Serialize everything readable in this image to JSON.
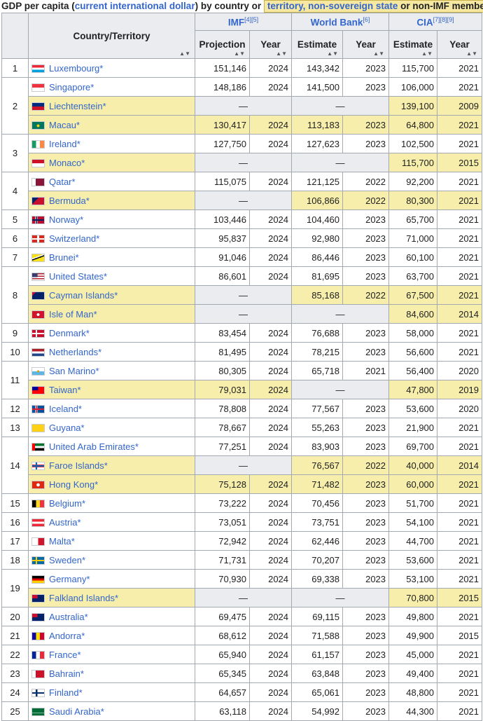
{
  "caption": {
    "text1": "GDP per capita (",
    "link": "current international dollar",
    "text2": ") by country or ",
    "box_a": "territory, ",
    "box_b": "non-sovereign state",
    "box_c": " or non-IMF member"
  },
  "header": {
    "country": "Country/Territory",
    "imf": "IMF",
    "imf_refs": "[4][5]",
    "wb": "World Bank",
    "wb_refs": "[6]",
    "cia": "CIA",
    "cia_refs": "[7][8][9]",
    "projection": "Projection",
    "estimate": "Estimate",
    "year": "Year",
    "sort_glyph": "▲▼"
  },
  "dash": "—",
  "star": "*",
  "colors": {
    "link": "#3366cc",
    "highlight": "#f6eeaa",
    "header_bg": "#eaecf0",
    "border": "#a2a9b1"
  },
  "rows": [
    {
      "rank": "1",
      "name": "Luxembourg",
      "flag": "luxembourg-flag",
      "f": "lu",
      "imf": "151,146",
      "imfy": "2024",
      "wb": "143,342",
      "wby": "2023",
      "cia": "115,700",
      "ciay": "2021",
      "terr": false
    },
    {
      "rank": "2",
      "name": "Singapore",
      "flag": "singapore-flag",
      "f": "sg",
      "imf": "148,186",
      "imfy": "2024",
      "wb": "141,500",
      "wby": "2023",
      "cia": "106,000",
      "ciay": "2021",
      "terr": false
    },
    {
      "rank": "",
      "name": "Liechtenstein",
      "flag": "liechtenstein-flag",
      "f": "li",
      "imf": null,
      "imfy": null,
      "wb": null,
      "wby": null,
      "cia": "139,100",
      "ciay": "2009",
      "terr": true
    },
    {
      "rank": "",
      "name": "Macau",
      "flag": "macau-flag",
      "f": "mo",
      "imf": "130,417",
      "imfy": "2024",
      "wb": "113,183",
      "wby": "2023",
      "cia": "64,800",
      "ciay": "2021",
      "terr": true
    },
    {
      "rank": "3",
      "name": "Ireland",
      "flag": "ireland-flag",
      "f": "ie",
      "imf": "127,750",
      "imfy": "2024",
      "wb": "127,623",
      "wby": "2023",
      "cia": "102,500",
      "ciay": "2021",
      "terr": false
    },
    {
      "rank": "",
      "name": "Monaco",
      "flag": "monaco-flag",
      "f": "mc",
      "imf": null,
      "imfy": null,
      "wb": null,
      "wby": null,
      "cia": "115,700",
      "ciay": "2015",
      "terr": true
    },
    {
      "rank": "4",
      "name": "Qatar",
      "flag": "qatar-flag",
      "f": "qa",
      "imf": "115,075",
      "imfy": "2024",
      "wb": "121,125",
      "wby": "2022",
      "cia": "92,200",
      "ciay": "2021",
      "terr": false
    },
    {
      "rank": "",
      "name": "Bermuda",
      "flag": "bermuda-flag",
      "f": "bm",
      "imf": null,
      "imfy": null,
      "wb": "106,866",
      "wby": "2022",
      "cia": "80,300",
      "ciay": "2021",
      "terr": true
    },
    {
      "rank": "5",
      "name": "Norway",
      "flag": "norway-flag",
      "f": "no",
      "imf": "103,446",
      "imfy": "2024",
      "wb": "104,460",
      "wby": "2023",
      "cia": "65,700",
      "ciay": "2021",
      "terr": false
    },
    {
      "rank": "6",
      "name": "Switzerland",
      "flag": "switzerland-flag",
      "f": "ch",
      "imf": "95,837",
      "imfy": "2024",
      "wb": "92,980",
      "wby": "2023",
      "cia": "71,000",
      "ciay": "2021",
      "terr": false
    },
    {
      "rank": "7",
      "name": "Brunei",
      "flag": "brunei-flag",
      "f": "bn",
      "imf": "91,046",
      "imfy": "2024",
      "wb": "86,446",
      "wby": "2023",
      "cia": "60,100",
      "ciay": "2021",
      "terr": false
    },
    {
      "rank": "8",
      "name": "United States",
      "flag": "united-states-flag",
      "f": "us",
      "imf": "86,601",
      "imfy": "2024",
      "wb": "81,695",
      "wby": "2023",
      "cia": "63,700",
      "ciay": "2021",
      "terr": false
    },
    {
      "rank": "",
      "name": "Cayman Islands",
      "flag": "cayman-islands-flag",
      "f": "ky",
      "imf": null,
      "imfy": null,
      "wb": "85,168",
      "wby": "2022",
      "cia": "67,500",
      "ciay": "2021",
      "terr": true
    },
    {
      "rank": "",
      "name": "Isle of Man",
      "flag": "isle-of-man-flag",
      "f": "im",
      "imf": null,
      "imfy": null,
      "wb": null,
      "wby": null,
      "cia": "84,600",
      "ciay": "2014",
      "terr": true
    },
    {
      "rank": "9",
      "name": "Denmark",
      "flag": "denmark-flag",
      "f": "dk",
      "imf": "83,454",
      "imfy": "2024",
      "wb": "76,688",
      "wby": "2023",
      "cia": "58,000",
      "ciay": "2021",
      "terr": false
    },
    {
      "rank": "10",
      "name": "Netherlands",
      "flag": "netherlands-flag",
      "f": "nl",
      "imf": "81,495",
      "imfy": "2024",
      "wb": "78,215",
      "wby": "2023",
      "cia": "56,600",
      "ciay": "2021",
      "terr": false
    },
    {
      "rank": "11",
      "name": "San Marino",
      "flag": "san-marino-flag",
      "f": "sm",
      "imf": "80,305",
      "imfy": "2024",
      "wb": "65,718",
      "wby": "2021",
      "cia": "56,400",
      "ciay": "2020",
      "terr": false
    },
    {
      "rank": "",
      "name": "Taiwan",
      "flag": "taiwan-flag",
      "f": "tw",
      "imf": "79,031",
      "imfy": "2024",
      "wb": null,
      "wby": null,
      "cia": "47,800",
      "ciay": "2019",
      "terr": true
    },
    {
      "rank": "12",
      "name": "Iceland",
      "flag": "iceland-flag",
      "f": "is",
      "imf": "78,808",
      "imfy": "2024",
      "wb": "77,567",
      "wby": "2023",
      "cia": "53,600",
      "ciay": "2020",
      "terr": false
    },
    {
      "rank": "13",
      "name": "Guyana",
      "flag": "guyana-flag",
      "f": "gy",
      "imf": "78,667",
      "imfy": "2024",
      "wb": "55,263",
      "wby": "2023",
      "cia": "21,900",
      "ciay": "2021",
      "terr": false
    },
    {
      "rank": "14",
      "name": "United Arab Emirates",
      "flag": "uae-flag",
      "f": "ae",
      "imf": "77,251",
      "imfy": "2024",
      "wb": "83,903",
      "wby": "2023",
      "cia": "69,700",
      "ciay": "2021",
      "terr": false
    },
    {
      "rank": "",
      "name": "Faroe Islands",
      "flag": "faroe-islands-flag",
      "f": "fo",
      "imf": null,
      "imfy": null,
      "wb": "76,567",
      "wby": "2022",
      "cia": "40,000",
      "ciay": "2014",
      "terr": true
    },
    {
      "rank": "",
      "name": "Hong Kong",
      "flag": "hong-kong-flag",
      "f": "hk",
      "imf": "75,128",
      "imfy": "2024",
      "wb": "71,482",
      "wby": "2023",
      "cia": "60,000",
      "ciay": "2021",
      "terr": true
    },
    {
      "rank": "15",
      "name": "Belgium",
      "flag": "belgium-flag",
      "f": "be",
      "imf": "73,222",
      "imfy": "2024",
      "wb": "70,456",
      "wby": "2023",
      "cia": "51,700",
      "ciay": "2021",
      "terr": false
    },
    {
      "rank": "16",
      "name": "Austria",
      "flag": "austria-flag",
      "f": "at",
      "imf": "73,051",
      "imfy": "2024",
      "wb": "73,751",
      "wby": "2023",
      "cia": "54,100",
      "ciay": "2021",
      "terr": false
    },
    {
      "rank": "17",
      "name": "Malta",
      "flag": "malta-flag",
      "f": "mt",
      "imf": "72,942",
      "imfy": "2024",
      "wb": "62,446",
      "wby": "2023",
      "cia": "44,700",
      "ciay": "2021",
      "terr": false
    },
    {
      "rank": "18",
      "name": "Sweden",
      "flag": "sweden-flag",
      "f": "se",
      "imf": "71,731",
      "imfy": "2024",
      "wb": "70,207",
      "wby": "2023",
      "cia": "53,600",
      "ciay": "2021",
      "terr": false
    },
    {
      "rank": "19",
      "name": "Germany",
      "flag": "germany-flag",
      "f": "de",
      "imf": "70,930",
      "imfy": "2024",
      "wb": "69,338",
      "wby": "2023",
      "cia": "53,100",
      "ciay": "2021",
      "terr": false
    },
    {
      "rank": "",
      "name": "Falkland Islands",
      "flag": "falkland-islands-flag",
      "f": "fk",
      "imf": null,
      "imfy": null,
      "wb": null,
      "wby": null,
      "cia": "70,800",
      "ciay": "2015",
      "terr": true
    },
    {
      "rank": "20",
      "name": "Australia",
      "flag": "australia-flag",
      "f": "au",
      "imf": "69,475",
      "imfy": "2024",
      "wb": "69,115",
      "wby": "2023",
      "cia": "49,800",
      "ciay": "2021",
      "terr": false
    },
    {
      "rank": "21",
      "name": "Andorra",
      "flag": "andorra-flag",
      "f": "ad",
      "imf": "68,612",
      "imfy": "2024",
      "wb": "71,588",
      "wby": "2023",
      "cia": "49,900",
      "ciay": "2015",
      "terr": false
    },
    {
      "rank": "22",
      "name": "France",
      "flag": "france-flag",
      "f": "fr",
      "imf": "65,940",
      "imfy": "2024",
      "wb": "61,157",
      "wby": "2023",
      "cia": "45,000",
      "ciay": "2021",
      "terr": false
    },
    {
      "rank": "23",
      "name": "Bahrain",
      "flag": "bahrain-flag",
      "f": "bh",
      "imf": "65,345",
      "imfy": "2024",
      "wb": "63,848",
      "wby": "2023",
      "cia": "49,400",
      "ciay": "2021",
      "terr": false
    },
    {
      "rank": "24",
      "name": "Finland",
      "flag": "finland-flag",
      "f": "fi",
      "imf": "64,657",
      "imfy": "2024",
      "wb": "65,061",
      "wby": "2023",
      "cia": "48,800",
      "ciay": "2021",
      "terr": false
    },
    {
      "rank": "25",
      "name": "Saudi Arabia",
      "flag": "saudi-arabia-flag",
      "f": "sa",
      "imf": "63,118",
      "imfy": "2024",
      "wb": "54,992",
      "wby": "2023",
      "cia": "44,300",
      "ciay": "2021",
      "terr": false
    }
  ]
}
